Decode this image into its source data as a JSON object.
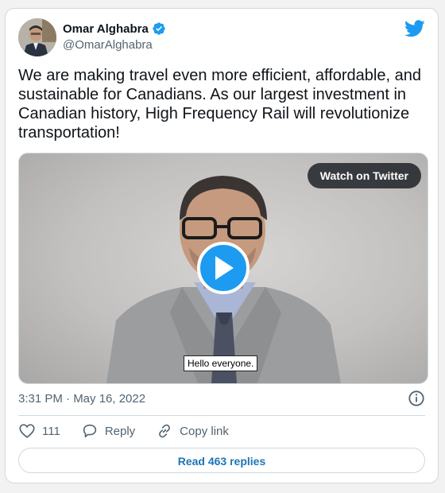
{
  "author": {
    "name": "Omar Alghabra",
    "handle": "@OmarAlghabra"
  },
  "tweet": {
    "text": "We are making travel even more efficient, affordable, and sustainable for Canadians. As our largest investment in Canadian history, High Frequency Rail will revolutionize transportation!",
    "timestamp": "3:31 PM · May 16, 2022"
  },
  "media": {
    "watch_label": "Watch on Twitter",
    "caption": "Hello everyone."
  },
  "actions": {
    "like_count": "111",
    "reply_label": "Reply",
    "copy_label": "Copy link"
  },
  "footer": {
    "read_replies": "Read 463 replies"
  },
  "icons": {
    "verified": "verified-badge-icon",
    "twitter": "twitter-bird-icon",
    "play": "play-icon",
    "info": "info-icon",
    "like": "heart-icon",
    "reply": "reply-bubble-icon",
    "copy": "link-icon"
  },
  "colors": {
    "accent": "#1d9bf0",
    "text": "#0f1419",
    "secondary": "#536471",
    "link": "#1d75b5",
    "border": "#cfd9de"
  }
}
